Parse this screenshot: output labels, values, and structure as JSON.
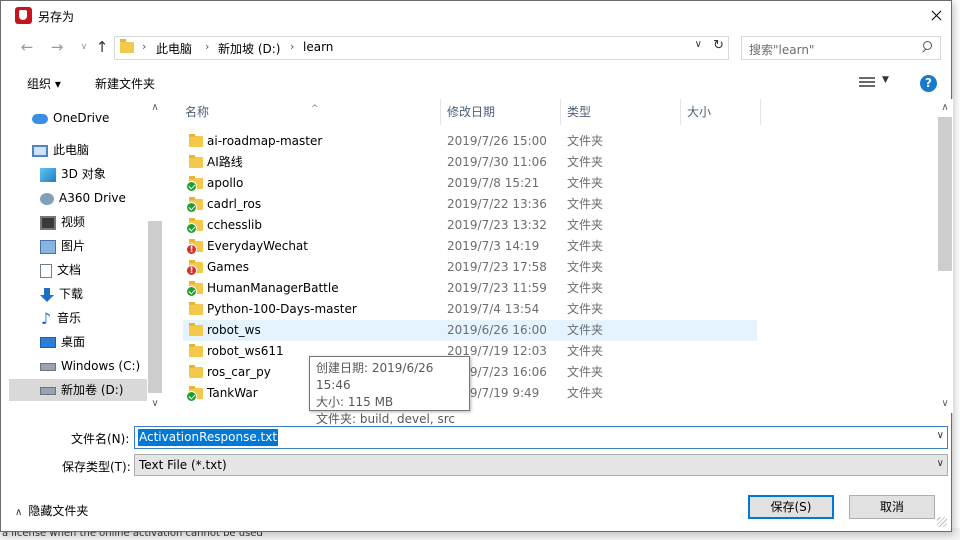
{
  "window": {
    "title": "另存为"
  },
  "nav": {
    "recent_icon": "chevron-down-icon",
    "breadcrumb": [
      "此电脑",
      "新加坡 (D:)",
      "learn"
    ],
    "search_placeholder": "搜索\"learn\""
  },
  "toolbar": {
    "organize": "组织 ▾",
    "new_folder": "新建文件夹"
  },
  "sidebar": {
    "items": [
      {
        "label": "OneDrive",
        "icon": "onedrive-icon"
      },
      {
        "label": "此电脑",
        "icon": "computer-icon"
      },
      {
        "label": "3D 对象",
        "icon": "3d-objects-icon"
      },
      {
        "label": "A360 Drive",
        "icon": "a360-drive-icon"
      },
      {
        "label": "视频",
        "icon": "video-icon"
      },
      {
        "label": "图片",
        "icon": "pictures-icon"
      },
      {
        "label": "文档",
        "icon": "documents-icon"
      },
      {
        "label": "下载",
        "icon": "downloads-icon"
      },
      {
        "label": "音乐",
        "icon": "music-icon"
      },
      {
        "label": "桌面",
        "icon": "desktop-icon"
      },
      {
        "label": "Windows (C:)",
        "icon": "drive-icon"
      },
      {
        "label": "新加卷 (D:)",
        "icon": "drive-icon"
      }
    ]
  },
  "columns": {
    "name": "名称",
    "date": "修改日期",
    "type": "类型",
    "size": "大小"
  },
  "files": [
    {
      "name": "ai-roadmap-master",
      "date": "2019/7/26 15:00",
      "type": "文件夹",
      "status": "none"
    },
    {
      "name": "AI路线",
      "date": "2019/7/30 11:06",
      "type": "文件夹",
      "status": "none"
    },
    {
      "name": "apollo",
      "date": "2019/7/8 15:21",
      "type": "文件夹",
      "status": "ok"
    },
    {
      "name": "cadrl_ros",
      "date": "2019/7/22 13:36",
      "type": "文件夹",
      "status": "ok"
    },
    {
      "name": "cchesslib",
      "date": "2019/7/23 13:32",
      "type": "文件夹",
      "status": "ok"
    },
    {
      "name": "EverydayWechat",
      "date": "2019/7/3 14:19",
      "type": "文件夹",
      "status": "error"
    },
    {
      "name": "Games",
      "date": "2019/7/23 17:58",
      "type": "文件夹",
      "status": "error"
    },
    {
      "name": "HumanManagerBattle",
      "date": "2019/7/23 11:59",
      "type": "文件夹",
      "status": "ok"
    },
    {
      "name": "Python-100-Days-master",
      "date": "2019/7/4 13:54",
      "type": "文件夹",
      "status": "none"
    },
    {
      "name": "robot_ws",
      "date": "2019/6/26 16:00",
      "type": "文件夹",
      "status": "none"
    },
    {
      "name": "robot_ws611",
      "date": "2019/7/19 12:03",
      "type": "文件夹",
      "status": "none"
    },
    {
      "name": "ros_car_py",
      "date": "2019/7/23 16:06",
      "type": "文件夹",
      "status": "none"
    },
    {
      "name": "TankWar",
      "date": "2019/7/19 9:49",
      "type": "文件夹",
      "status": "ok"
    }
  ],
  "tooltip": {
    "line1": "创建日期: 2019/6/26 15:46",
    "line2": "大小: 115 MB",
    "line3": "文件夹: build, devel, src"
  },
  "form": {
    "filename_label": "文件名(N):",
    "filename_value": "ActivationResponse.txt",
    "filetype_label": "保存类型(T):",
    "filetype_value": "Text File (*.txt)"
  },
  "footer": {
    "hide_folders": "隐藏文件夹",
    "save": "保存(S)",
    "cancel": "取消"
  },
  "background_text": "a license when the online activation cannot be used",
  "colors": {
    "accent": "#0078d7",
    "folder": "#f3c84b",
    "hover_row": "#e5f3ff",
    "selected_nav": "#d9d9d9",
    "sync_ok": "#1e9f2e",
    "sync_error": "#d32d2d"
  }
}
